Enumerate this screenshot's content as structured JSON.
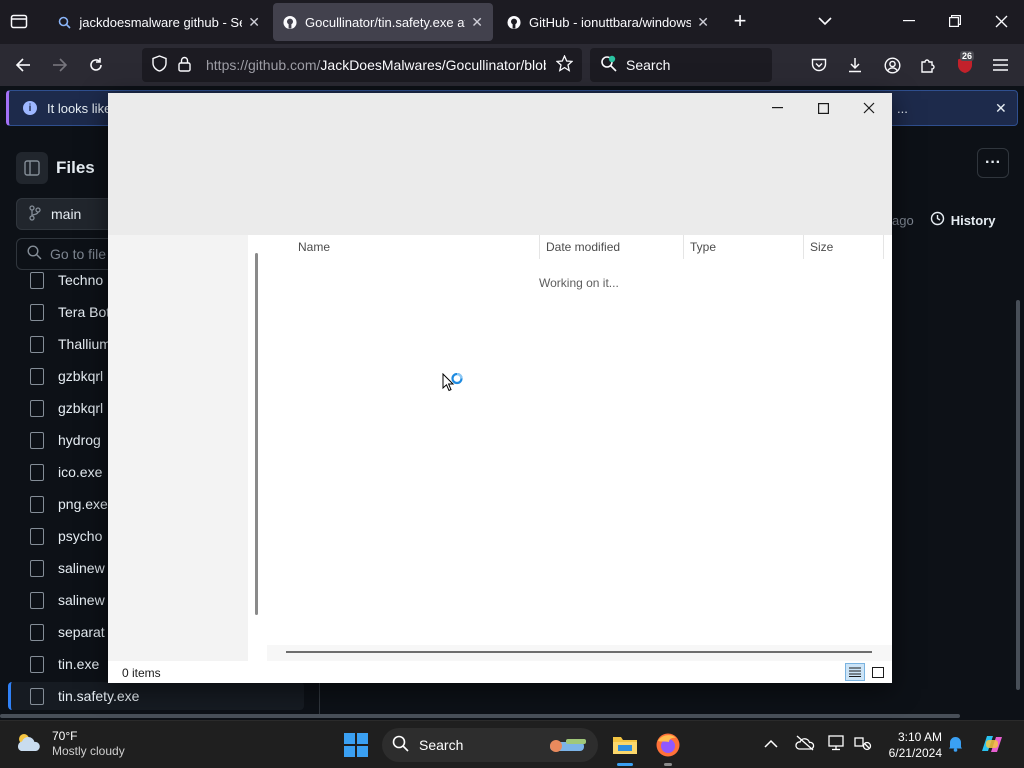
{
  "browser": {
    "tabs": [
      {
        "title": "jackdoesmalware github - Search",
        "active": false
      },
      {
        "title": "Gocullinator/tin.safety.exe at main",
        "active": true
      },
      {
        "title": "GitHub - ionuttbara/windows-defender-remover",
        "active": false
      }
    ],
    "url": {
      "domain_part": "https://github.com/",
      "path_part": "JackDoesMalwares/Gocullinator/blob/main/tin.safety.exe"
    },
    "search_placeholder": "Search",
    "extension_badge": "26"
  },
  "banner": {
    "text": "It looks like"
  },
  "github": {
    "files_title": "Files",
    "branch": "main",
    "goto_placeholder": "Go to file",
    "files": [
      "Techno",
      "Tera Bot",
      "Thallium",
      "gzbkqrl",
      "gzbkqrl",
      "hydrog",
      "ico.exe",
      "png.exe",
      "psycho",
      "salinew",
      "salinew",
      "separat",
      "tin.exe",
      "tin.safety.exe"
    ],
    "commit_ago": "ago",
    "history_label": "History"
  },
  "dialog": {
    "columns": {
      "name": "Name",
      "date_modified": "Date modified",
      "type": "Type",
      "size": "Size"
    },
    "working_text": "Working on it...",
    "status": "0 items"
  },
  "taskbar": {
    "weather_temp": "70°F",
    "weather_desc": "Mostly cloudy",
    "search_label": "Search",
    "time": "3:10 AM",
    "date": "6/21/2024",
    "accent": "#3aa0f3"
  }
}
